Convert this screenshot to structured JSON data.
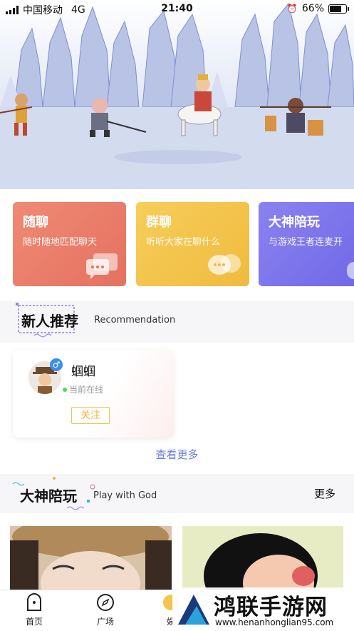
{
  "status_bar": {
    "carrier": "中国移动",
    "network": "4G",
    "time": "21:40",
    "battery": "66%"
  },
  "feature_cards": [
    {
      "title": "随聊",
      "subtitle": "随时随地匹配聊天",
      "color": "#e97a66"
    },
    {
      "title": "群聊",
      "subtitle": "听听大家在聊什么",
      "color": "#f3c54a"
    },
    {
      "title": "大神陪玩",
      "subtitle": "与游戏王者连麦开",
      "color": "#7a72ec"
    }
  ],
  "recommend": {
    "title": "新人推荐",
    "subtitle": "Recommendation",
    "person": {
      "name": "蝈蝈",
      "gender": "♂",
      "status": "当前在线",
      "follow_label": "关注"
    },
    "see_more": "查看更多"
  },
  "god": {
    "title": "大神陪玩",
    "subtitle": "Play with God",
    "more": "更多"
  },
  "tabs": [
    {
      "label": "首页",
      "icon": "home-icon"
    },
    {
      "label": "广场",
      "icon": "compass-icon"
    },
    {
      "label": "娱",
      "icon": "entertainment-icon"
    }
  ],
  "watermark": {
    "text": "鸿联手游网",
    "url": "www.henanhonglian95.com"
  }
}
